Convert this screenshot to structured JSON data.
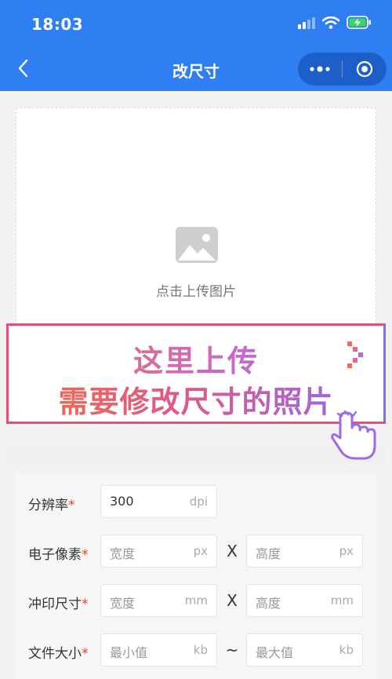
{
  "status": {
    "time": "18:03"
  },
  "nav": {
    "title": "改尺寸"
  },
  "upload": {
    "label": "点击上传图片"
  },
  "banner": {
    "line1": "这里上传",
    "line2": "需要修改尺寸的照片"
  },
  "form": {
    "resolution": {
      "label": "分辨率",
      "required": "*",
      "value": "300",
      "unit": "dpi"
    },
    "pixels": {
      "label": "电子像素",
      "required": "*",
      "separator": "X",
      "width": {
        "placeholder": "宽度",
        "unit": "px"
      },
      "height": {
        "placeholder": "高度",
        "unit": "px"
      }
    },
    "print_size": {
      "label": "冲印尺寸",
      "required": "*",
      "separator": "X",
      "width": {
        "placeholder": "宽度",
        "unit": "mm"
      },
      "height": {
        "placeholder": "高度",
        "unit": "mm"
      }
    },
    "file_size": {
      "label": "文件大小",
      "required": "*",
      "separator": "~",
      "min": {
        "placeholder": "最小值",
        "unit": "kb"
      },
      "max": {
        "placeholder": "最大值",
        "unit": "kb"
      }
    }
  },
  "icons": [
    "back-arrow-icon",
    "more-dots-icon",
    "close-target-icon",
    "image-icon",
    "cellular-signal-icon",
    "wifi-icon",
    "battery-charging-icon",
    "pointer-hand-icon"
  ],
  "colors": {
    "header": "#2f7ff2",
    "capsule": "#1d5fc9",
    "required": "#e0452e",
    "banner_border": "#e84e73"
  }
}
